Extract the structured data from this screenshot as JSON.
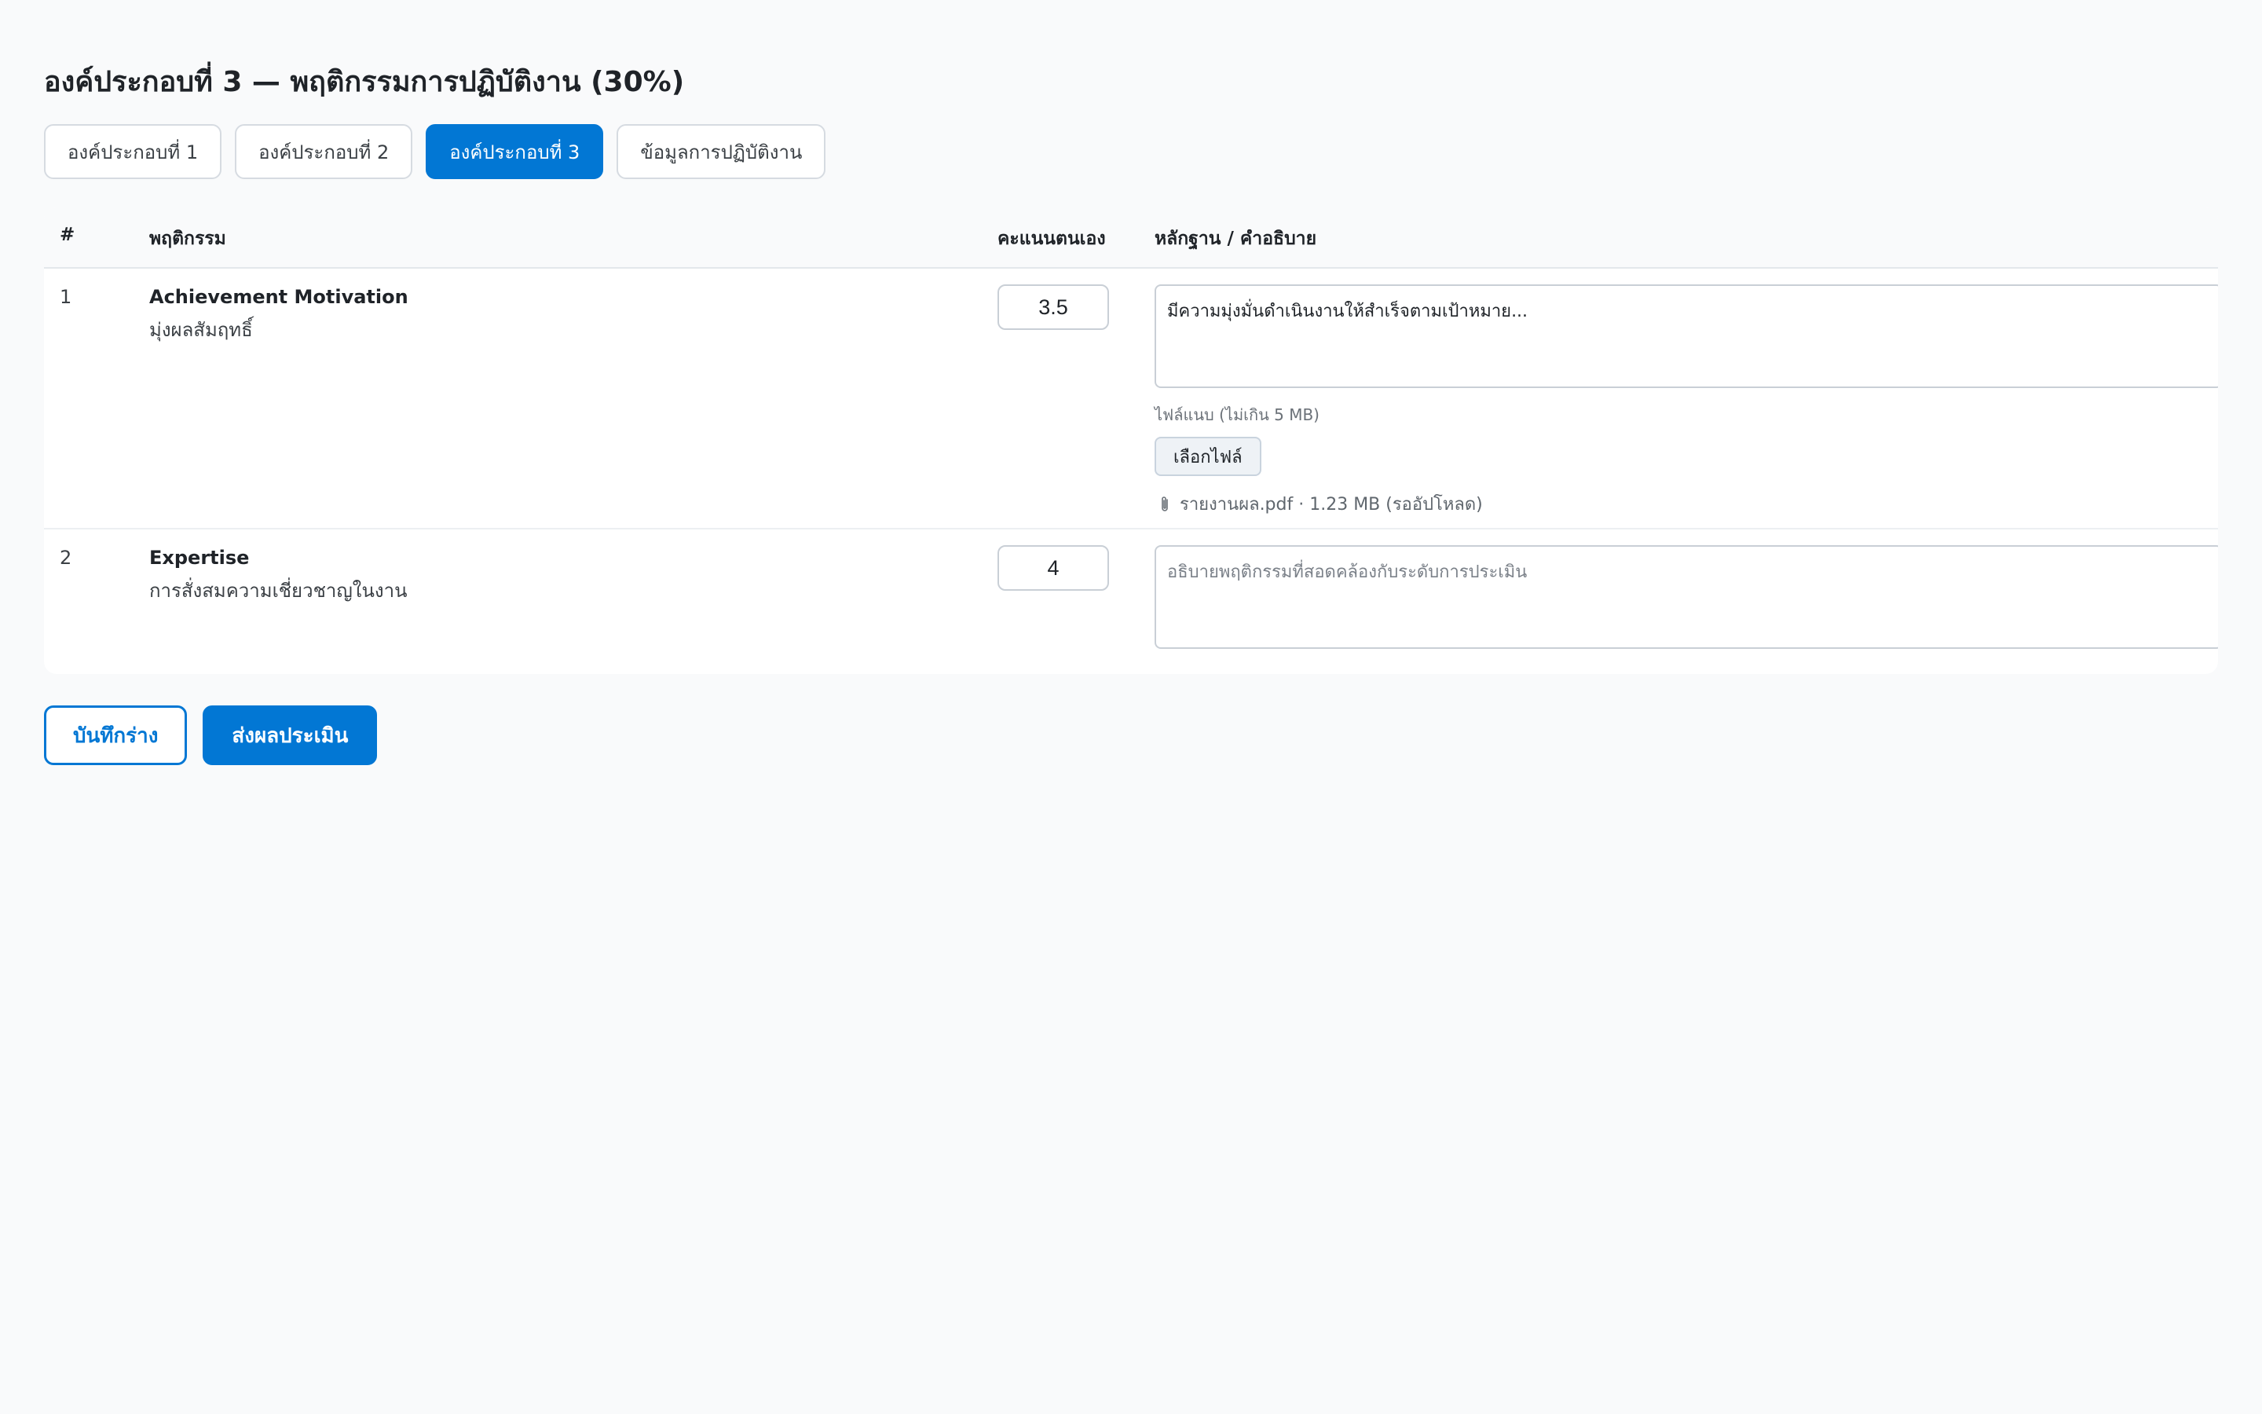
{
  "page": {
    "title": "องค์ประกอบที่ 3 — พฤติกรรมการปฏิบัติงาน (30%)"
  },
  "tabs": [
    {
      "label": "องค์ประกอบที่ 1",
      "active": false
    },
    {
      "label": "องค์ประกอบที่ 2",
      "active": false
    },
    {
      "label": "องค์ประกอบที่ 3",
      "active": true
    },
    {
      "label": "ข้อมูลการปฏิบัติงาน",
      "active": false
    }
  ],
  "table": {
    "headers": {
      "num": "#",
      "behavior": "พฤติกรรม",
      "score": "คะแนนตนเอง",
      "evidence": "หลักฐาน / คำอธิบาย"
    },
    "rows": [
      {
        "num": "1",
        "title_en": "Achievement Motivation",
        "title_th": "มุ่งผลสัมฤทธิ์",
        "score": "3.5",
        "evidence_value": "มีความมุ่งมั่นดำเนินงานให้สำเร็จตามเป้าหมาย...",
        "evidence_placeholder": "",
        "attachment_label": "ไฟล์แนบ (ไม่เกิน 5 MB)",
        "file_button_label": "เลือกไฟล์",
        "file_info": "รายงานผล.pdf · 1.23 MB (รออัปโหลด)"
      },
      {
        "num": "2",
        "title_en": "Expertise",
        "title_th": "การสั่งสมความเชี่ยวชาญในงาน",
        "score": "4",
        "evidence_value": "",
        "evidence_placeholder": "อธิบายพฤติกรรมที่สอดคล้องกับระดับการประเมิน"
      }
    ]
  },
  "actions": {
    "save_draft": "บันทึกร่าง",
    "submit": "ส่งผลประเมิน"
  },
  "colors": {
    "accent": "#0277d4",
    "background": "#f9fafb",
    "border": "#c9cfd6"
  },
  "icons": {
    "attachment": "paperclip-icon"
  }
}
